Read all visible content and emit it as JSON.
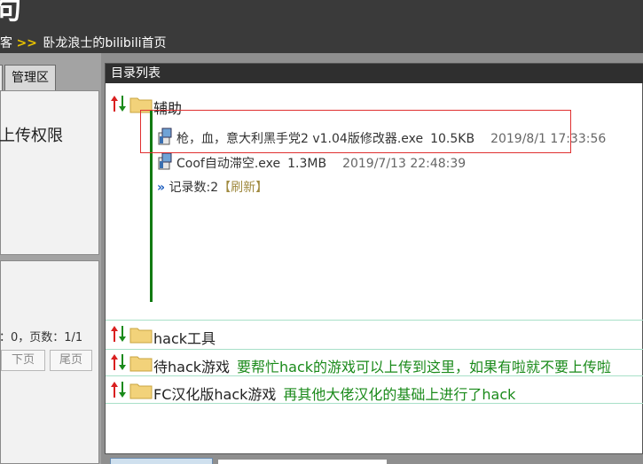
{
  "banner": {
    "title_fragment": "句",
    "crumb_prefix": "客",
    "crumb_arrows": ">>",
    "crumb_page": "卧龙浪士的bilibili首页"
  },
  "left_panel": {
    "tabs": [
      "",
      "管理区"
    ],
    "permission_text": "上传权限",
    "stats_text": "：0，页数：1/1",
    "next_button": "下页",
    "last_button": "尾页"
  },
  "main": {
    "header": "目录列表",
    "folders": [
      {
        "name": "辅助",
        "desc": ""
      },
      {
        "name": "hack工具",
        "desc": ""
      },
      {
        "name": "待hack游戏",
        "desc": "要帮忙hack的游戏可以上传到这里，如果有啦就不要上传啦"
      },
      {
        "name": "FC汉化版hack游戏",
        "desc": "再其他大佬汉化的基础上进行了hack"
      }
    ],
    "files": [
      {
        "name": "枪，血，意大利黑手党2 v1.04版修改器.exe",
        "size": "10.5KB",
        "date": "2019/8/1 17:33:56"
      },
      {
        "name": "Coof自动滞空.exe",
        "size": "1.3MB",
        "date": "2019/7/13 22:48:39"
      }
    ],
    "record_chevron": "»",
    "record_text": "记录数:2",
    "refresh_label": "【刷新】"
  },
  "colors": {
    "accent_green": "#1a8a1a",
    "highlight_red": "#e03030",
    "header_dark": "#2f2f2f"
  }
}
